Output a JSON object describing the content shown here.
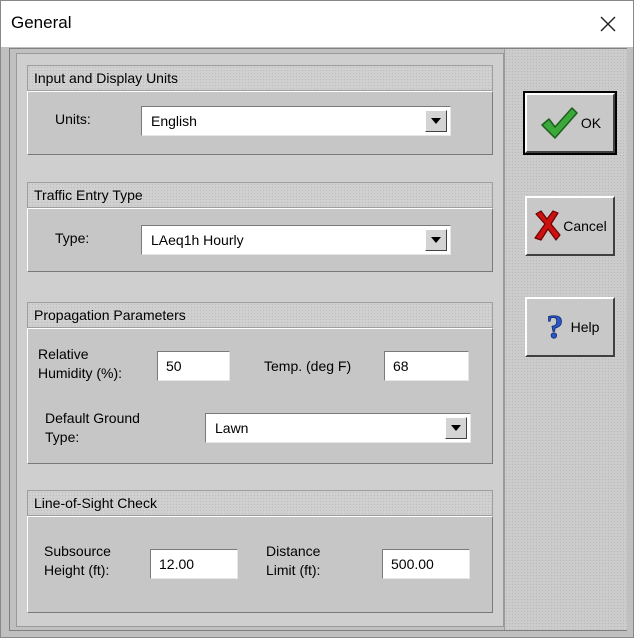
{
  "window": {
    "title": "General"
  },
  "groups": {
    "units": {
      "header": "Input and Display Units",
      "label": "Units:",
      "value": "English"
    },
    "traffic": {
      "header": "Traffic Entry Type",
      "label": "Type:",
      "value": "LAeq1h Hourly"
    },
    "propagation": {
      "header": "Propagation Parameters",
      "humidity_label_line1": "Relative",
      "humidity_label_line2": "Humidity (%):",
      "humidity_value": "50",
      "temp_label": "Temp. (deg F)",
      "temp_value": "68",
      "ground_label_line1": "Default Ground",
      "ground_label_line2": "Type:",
      "ground_value": "Lawn"
    },
    "los": {
      "header": "Line-of-Sight Check",
      "height_label_line1": "Subsource",
      "height_label_line2": "Height (ft):",
      "height_value": "12.00",
      "distance_label_line1": "Distance",
      "distance_label_line2": "Limit (ft):",
      "distance_value": "500.00"
    }
  },
  "buttons": {
    "ok": "OK",
    "cancel": "Cancel",
    "help": "Help"
  },
  "icons": {
    "close": "close-icon",
    "ok": "checkmark-icon",
    "cancel": "red-x-icon",
    "help": "question-mark-icon"
  },
  "colors": {
    "checkmark": "#3aa93a",
    "cancel_x": "#cc1111",
    "help": "#2a56c6"
  }
}
